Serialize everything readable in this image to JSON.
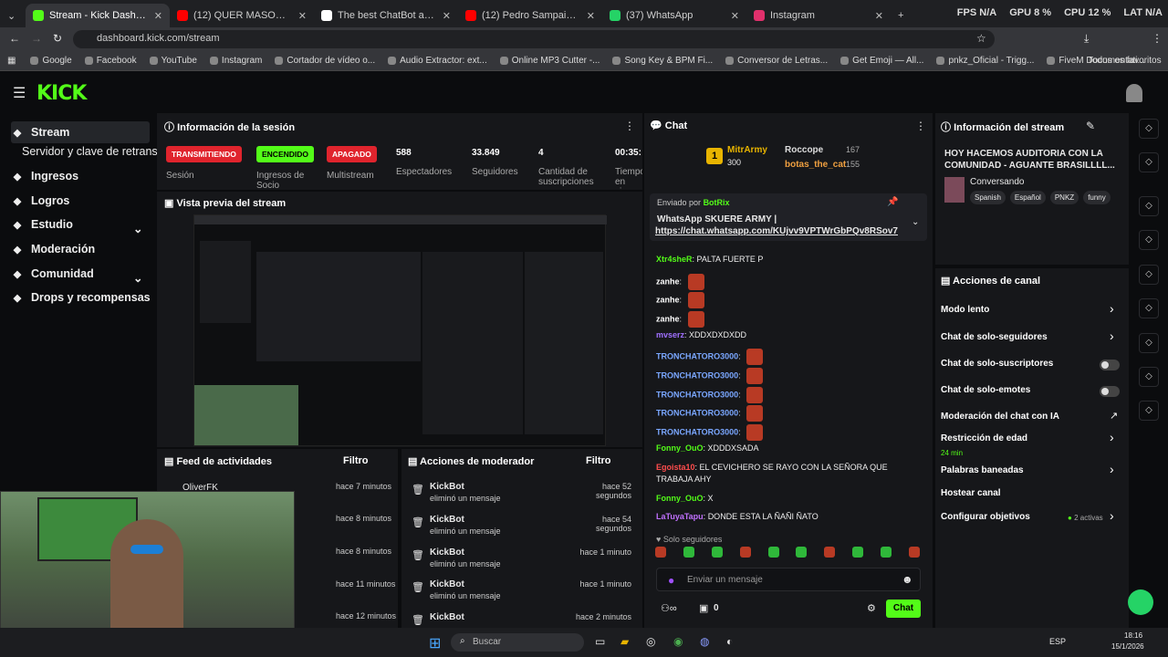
{
  "tabs": [
    {
      "label": "Stream - Kick Dashboard",
      "color": "#53fc18",
      "active": true
    },
    {
      "label": "(12) QUER MASOQUISTA ENTÃ",
      "color": "#ff0000"
    },
    {
      "label": "The best ChatBot and Widgets",
      "color": "#ffffff"
    },
    {
      "label": "(12) Pedro Sampaio, Felipe Orig",
      "color": "#ff0000"
    },
    {
      "label": "(37) WhatsApp",
      "color": "#25d366"
    },
    {
      "label": "Instagram",
      "color": "#e1306c"
    }
  ],
  "perf": {
    "fps": "FPS N/A",
    "gpu": "GPU 8 %",
    "cpu": "CPU 12 %",
    "lat": "LAT N/A"
  },
  "url": "dashboard.kick.com/stream",
  "bookmarks": [
    "Google",
    "Facebook",
    "YouTube",
    "Instagram",
    "Cortador de vídeo o...",
    "Audio Extractor: ext...",
    "Online MP3 Cutter -...",
    "Song Key & BPM Fi...",
    "Conversor de Letras...",
    "Get Emoji — All...",
    "pnkz_Oficial - Trigg...",
    "FiveM Documentati..."
  ],
  "bookmarks_all": "Todos os favoritos",
  "logo": "KICK",
  "sidebar": {
    "items": [
      {
        "label": "Stream",
        "icon": "stream-icon"
      },
      {
        "label": "Servidor y clave de retransm",
        "icon": ""
      },
      {
        "label": "Ingresos",
        "icon": "revenue-icon"
      },
      {
        "label": "Logros",
        "icon": "trophy-icon"
      },
      {
        "label": "Estudio",
        "icon": "studio-icon"
      },
      {
        "label": "Moderación",
        "icon": "wrench-icon"
      },
      {
        "label": "Comunidad",
        "icon": "community-icon"
      },
      {
        "label": "Drops y recompensas",
        "icon": "drops-icon"
      }
    ]
  },
  "session": {
    "title": "Información de la sesión",
    "badges": [
      "TRANSMITIENDO",
      "ENCENDIDO",
      "APAGADO"
    ],
    "labels": [
      "Sesión",
      "Ingresos de Socio",
      "Multistream"
    ],
    "stats": [
      {
        "value": "588",
        "label": "Espectadores"
      },
      {
        "value": "33.849",
        "label": "Seguidores"
      },
      {
        "value": "4",
        "label": "Cantidad de suscripciones"
      },
      {
        "value": "00:35:",
        "label": "Tiempo en vivo"
      }
    ]
  },
  "preview": {
    "title": "Vista previa del stream"
  },
  "feed": {
    "title": "Feed de actividades",
    "filter": "Filtro",
    "user": "OliverFK",
    "times": [
      "hace 7 minutos",
      "hace 8 minutos",
      "hace 8 minutos",
      "hace 11 minutos",
      "hace 12 minutos"
    ]
  },
  "modactions": {
    "title": "Acciones de moderador",
    "filter": "Filtro",
    "rows": [
      {
        "user": "KickBot",
        "action": "eliminó un mensaje",
        "time": "hace 52 segundos"
      },
      {
        "user": "KickBot",
        "action": "eliminó un mensaje",
        "time": "hace 54 segundos"
      },
      {
        "user": "KickBot",
        "action": "eliminó un mensaje",
        "time": "hace 1 minuto"
      },
      {
        "user": "KickBot",
        "action": "eliminó un mensaje",
        "time": "hace 1 minuto"
      },
      {
        "user": "KickBot",
        "action": "eliminó un mensaje",
        "time": "hace 2 minutos"
      }
    ]
  },
  "chat": {
    "title": "Chat",
    "top": {
      "rank1": "MitrArmy",
      "rank1_amt": "300",
      "rank2": "Roccope",
      "rank2_amt": "167",
      "rank3": "botas_the_cat",
      "rank3_amt": "155"
    },
    "pinned_by": "Enviado por",
    "pinned_user": "BotRix",
    "pinned_text": "WhatsApp SKUERE ARMY |",
    "pinned_link": "https://chat.whatsapp.com/KUjvv9VPTWrGbPQv8RSov7",
    "messages": [
      {
        "user": "Xtr4sheR",
        "color": "#53fc18",
        "text": "PALTA FUERTE P"
      },
      {
        "user": "zanhe",
        "color": "#fff",
        "text": ""
      },
      {
        "user": "zanhe",
        "color": "#fff",
        "text": ""
      },
      {
        "user": "zanhe",
        "color": "#fff",
        "text": ""
      },
      {
        "user": "mvserz",
        "color": "#a070ff",
        "text": "XDDXDXDXDD"
      },
      {
        "user": "TRONCHATORO3000",
        "color": "#7aa7ff",
        "text": ""
      },
      {
        "user": "TRONCHATORO3000",
        "color": "#7aa7ff",
        "text": ""
      },
      {
        "user": "TRONCHATORO3000",
        "color": "#7aa7ff",
        "text": ""
      },
      {
        "user": "TRONCHATORO3000",
        "color": "#7aa7ff",
        "text": ""
      },
      {
        "user": "TRONCHATORO3000",
        "color": "#7aa7ff",
        "text": ""
      },
      {
        "user": "Fonny_OuO",
        "color": "#53fc18",
        "text": "XDDDXSADA"
      },
      {
        "user": "Egoista10",
        "color": "#ff4d4d",
        "text": "EL CEVICHERO SE RAYO CON LA SEÑORA QUE TRABAJA AHY"
      },
      {
        "user": "Fonny_OuO",
        "color": "#53fc18",
        "text": "X"
      },
      {
        "user": "LaTuyaTapu",
        "color": "#c070ff",
        "text": "DONDE ESTA LA ÑAÑI ÑATO"
      }
    ],
    "followers_only": "Solo seguidores",
    "placeholder": "Enviar un mensaje",
    "send": "Chat",
    "points": "0"
  },
  "streaminfo": {
    "title": "Información del stream",
    "stream_title": "HOY HACEMOS AUDITORIA CON LA COMUNIDAD - AGUANTE BRASILLLL...",
    "category": "Conversando",
    "tags": [
      "Spanish",
      "Español",
      "PNKZ",
      "funny"
    ]
  },
  "actions": {
    "title": "Acciones de canal",
    "rows": [
      "Modo lento",
      "Chat de solo-seguidores",
      "Chat de solo-suscriptores",
      "Chat de solo-emotes",
      "Moderación del chat con IA",
      "Restricción de edad",
      "Palabras baneadas",
      "Hostear canal",
      "Configurar objetivos"
    ],
    "age_sub": "24 min",
    "goals_sub": "2 activas"
  },
  "taskbar": {
    "search": "Buscar",
    "lang": "ESP",
    "time": "18:16",
    "date": "15/1/2026"
  }
}
